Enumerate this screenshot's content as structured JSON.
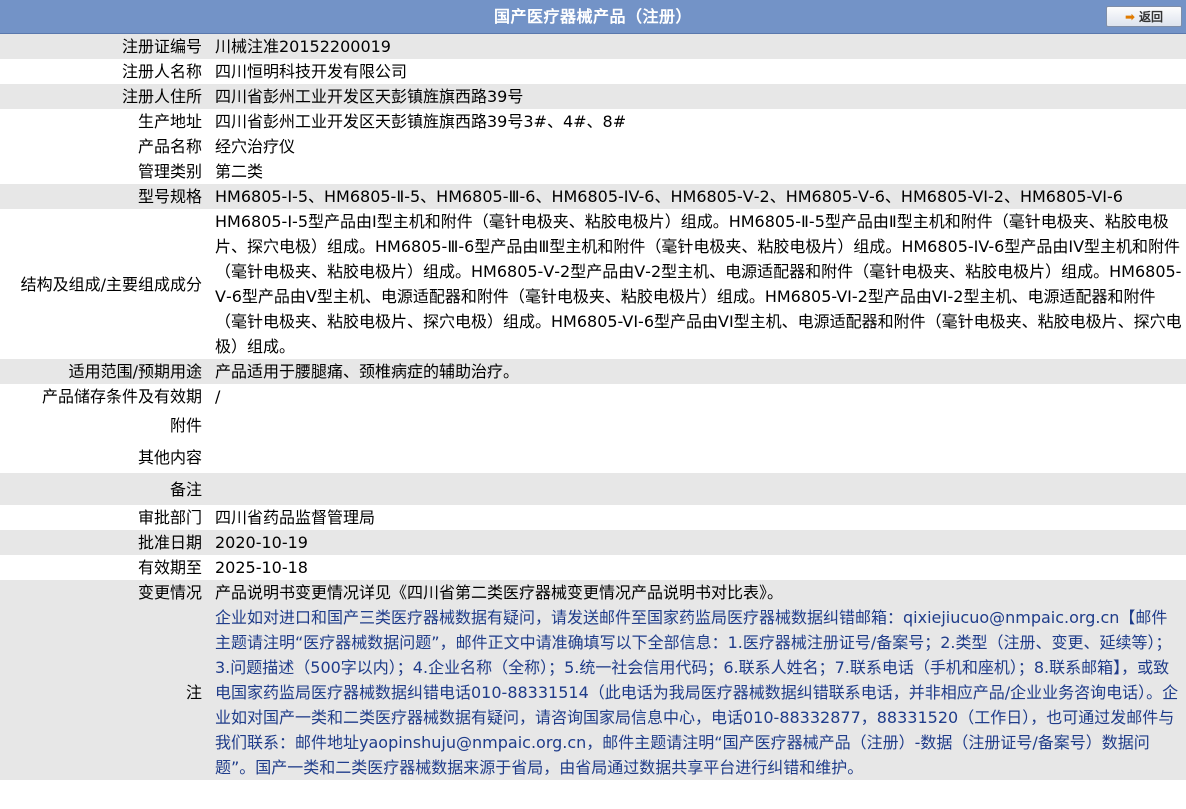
{
  "header": {
    "title": "国产医疗器械产品（注册）",
    "back_label": "返回"
  },
  "rows": [
    {
      "label": "注册证编号",
      "value": "川械注准20152200019"
    },
    {
      "label": "注册人名称",
      "value": "四川恒明科技开发有限公司"
    },
    {
      "label": "注册人住所",
      "value": "四川省彭州工业开发区天彭镇旌旗西路39号"
    },
    {
      "label": "生产地址",
      "value": "四川省彭州工业开发区天彭镇旌旗西路39号3#、4#、8#"
    },
    {
      "label": "产品名称",
      "value": "经穴治疗仪"
    },
    {
      "label": "管理类别",
      "value": "第二类"
    },
    {
      "label": "型号规格",
      "value": "HM6805-Ⅰ-5、HM6805-Ⅱ-5、HM6805-Ⅲ-6、HM6805-IV-6、HM6805-Ⅴ-2、HM6805-Ⅴ-6、HM6805-VI-2、HM6805-VI-6"
    },
    {
      "label": "结构及组成/主要组成成分",
      "value": "HM6805-Ⅰ-5型产品由Ⅰ型主机和附件（毫针电极夹、粘胶电极片）组成。HM6805-Ⅱ-5型产品由Ⅱ型主机和附件（毫针电极夹、粘胶电极片、探穴电极）组成。HM6805-Ⅲ-6型产品由Ⅲ型主机和附件（毫针电极夹、粘胶电极片）组成。HM6805-IV-6型产品由IV型主机和附件（毫针电极夹、粘胶电极片）组成。HM6805-Ⅴ-2型产品由Ⅴ-2型主机、电源适配器和附件（毫针电极夹、粘胶电极片）组成。HM6805-Ⅴ-6型产品由Ⅴ型主机、电源适配器和附件（毫针电极夹、粘胶电极片）组成。HM6805-VI-2型产品由VI-2型主机、电源适配器和附件（毫针电极夹、粘胶电极片、探穴电极）组成。HM6805-VI-6型产品由VI型主机、电源适配器和附件（毫针电极夹、粘胶电极片、探穴电极）组成。"
    },
    {
      "label": "适用范围/预期用途",
      "value": "产品适用于腰腿痛、颈椎病症的辅助治疗。"
    },
    {
      "label": "产品储存条件及有效期",
      "value": "/"
    },
    {
      "label": "附件",
      "value": ""
    },
    {
      "label": "其他内容",
      "value": ""
    },
    {
      "label": "备注",
      "value": ""
    },
    {
      "label": "审批部门",
      "value": "四川省药品监督管理局"
    },
    {
      "label": "批准日期",
      "value": "2020-10-19"
    },
    {
      "label": "有效期至",
      "value": "2025-10-18"
    },
    {
      "label": "变更情况",
      "value": "产品说明书变更情况详见《四川省第二类医疗器械变更情况产品说明书对比表》。"
    }
  ],
  "note": {
    "label": "注",
    "text": "企业如对进口和国产三类医疗器械数据有疑问，请发送邮件至国家药监局医疗器械数据纠错邮箱：qixiejiucuo@nmpaic.org.cn【邮件主题请注明“医疗器械数据问题”，邮件正文中请准确填写以下全部信息：1.医疗器械注册证号/备案号；2.类型（注册、变更、延续等）；3.问题描述（500字以内）；4.企业名称（全称）；5.统一社会信用代码；6.联系人姓名；7.联系电话（手机和座机）；8.联系邮箱】，或致电国家药监局医疗器械数据纠错电话010-88331514（此电话为我局医疗器械数据纠错联系电话，并非相应产品/企业业务咨询电话）。企业如对国产一类和二类医疗器械数据有疑问，请咨询国家局信息中心，电话010-88332877，88331520（工作日），也可通过发邮件与我们联系：邮件地址yaopinshuju@nmpaic.org.cn，邮件主题请注明“国产医疗器械产品（注册）-数据（注册证号/备案号）数据问题”。国产一类和二类医疗器械数据来源于省局，由省局通过数据共享平台进行纠错和维护。"
  }
}
